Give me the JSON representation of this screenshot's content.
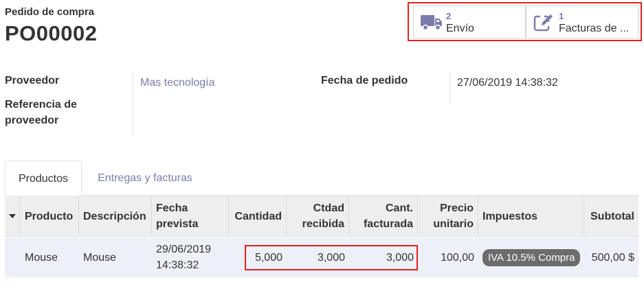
{
  "header": {
    "subtitle": "Pedido de compra",
    "title": "PO00002"
  },
  "smart_buttons": {
    "shipping": {
      "count": "2",
      "label": "Envío",
      "icon": "truck-icon"
    },
    "invoices": {
      "count": "1",
      "label": "Facturas de ...",
      "icon": "edit-icon"
    }
  },
  "fields": {
    "vendor_label": "Proveedor",
    "vendor_value": "Mas tecnología",
    "vendor_ref_label_line1": "Referencia de",
    "vendor_ref_label_line2": "proveedor",
    "order_date_label": "Fecha de pedido",
    "order_date_value": "27/06/2019 14:38:32"
  },
  "tabs": [
    {
      "label": "Productos",
      "active": true
    },
    {
      "label": "Entregas y facturas",
      "active": false
    }
  ],
  "table": {
    "headers": {
      "product": "Producto",
      "description": "Descripción",
      "date_planned_1": "Fecha",
      "date_planned_2": "prevista",
      "quantity": "Cantidad",
      "qty_received_1": "Ctdad",
      "qty_received_2": "recibida",
      "qty_invoiced_1": "Cant.",
      "qty_invoiced_2": "facturada",
      "price_unit_1": "Precio",
      "price_unit_2": "unitario",
      "taxes": "Impuestos",
      "subtotal": "Subtotal"
    },
    "rows": [
      {
        "product": "Mouse",
        "description": "Mouse",
        "date_planned_1": "29/06/2019",
        "date_planned_2": "14:38:32",
        "quantity": "5,000",
        "qty_received": "3,000",
        "qty_invoiced": "3,000",
        "price_unit": "100,00",
        "taxes": "IVA 10.5% Compra",
        "subtotal": "500,00 $"
      }
    ]
  },
  "colors": {
    "link": "#7c7bad",
    "highlight": "#e02020",
    "row_bg": "#eef0f8",
    "header_bg": "#eeeeee"
  }
}
